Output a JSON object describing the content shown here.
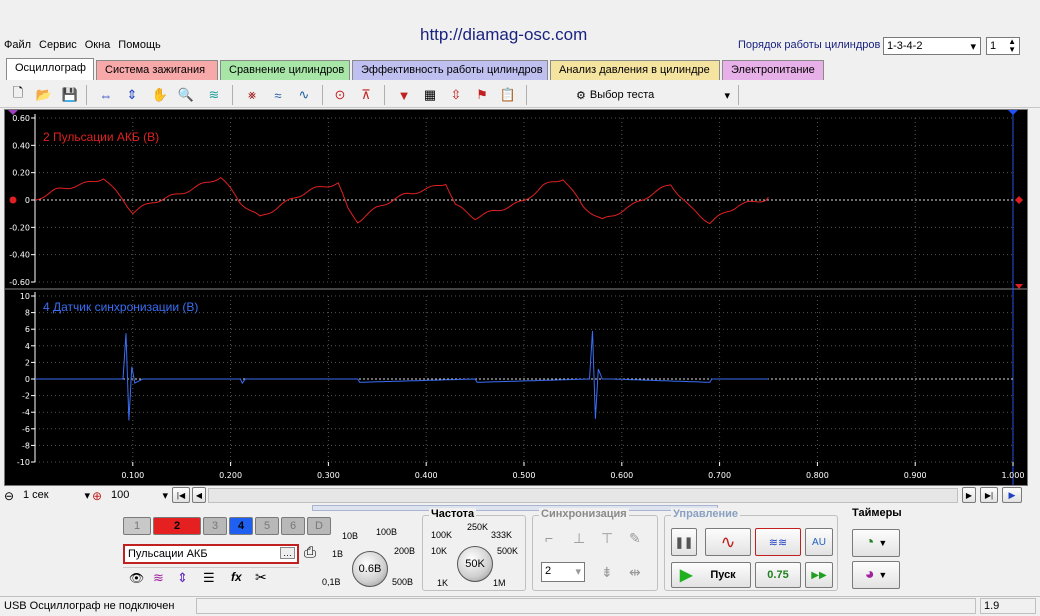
{
  "title_url": "http://diamag-osc.com",
  "menu": [
    "Файл",
    "Сервис",
    "Окна",
    "Помощь"
  ],
  "cyl_order": {
    "label": "Порядок работы цилиндров",
    "value": "1-3-4-2",
    "count": "1"
  },
  "tabs": [
    {
      "label": "Осциллограф",
      "color": "#f0f0f0",
      "active": true
    },
    {
      "label": "Система зажигания",
      "color": "#f7a8a8"
    },
    {
      "label": "Сравнение цилиндров",
      "color": "#a8e6a8"
    },
    {
      "label": "Эффективность работы цилиндров",
      "color": "#c0c0f0"
    },
    {
      "label": "Анализ давления в цилиндре",
      "color": "#f5e4a0"
    },
    {
      "label": "Электропитание",
      "color": "#e8b0e8"
    }
  ],
  "test_select": "Выбор теста",
  "chart_data": [
    {
      "type": "line",
      "title": "2 Пульсации АКБ (В)",
      "color": "#e02020",
      "ylim": [
        -0.6,
        0.6
      ],
      "yticks": [
        "0.60",
        "0.40",
        "0.20",
        "0",
        "-0.20",
        "-0.40",
        "-0.60"
      ],
      "x": [
        0.0,
        0.02,
        0.05,
        0.07,
        0.09,
        0.1,
        0.12,
        0.15,
        0.19,
        0.21,
        0.23,
        0.25,
        0.28,
        0.31,
        0.32,
        0.33,
        0.35,
        0.38,
        0.42,
        0.43,
        0.45,
        0.47,
        0.5,
        0.52,
        0.54,
        0.56,
        0.58,
        0.61,
        0.65,
        0.67,
        0.69,
        0.72,
        0.75
      ],
      "y": [
        0.0,
        0.06,
        0.12,
        0.17,
        0.0,
        -0.1,
        -0.02,
        0.06,
        0.16,
        -0.02,
        -0.12,
        -0.04,
        0.06,
        0.13,
        -0.06,
        -0.15,
        -0.06,
        0.04,
        0.13,
        -0.04,
        -0.14,
        -0.08,
        0.0,
        0.1,
        0.15,
        -0.04,
        -0.14,
        -0.05,
        0.12,
        -0.05,
        -0.17,
        -0.04,
        0.02
      ]
    },
    {
      "type": "line",
      "title": "4 Датчик синхронизации (В)",
      "color": "#3a6ef5",
      "ylim": [
        -10,
        10
      ],
      "yticks": [
        "10",
        "8",
        "6",
        "4",
        "2",
        "0",
        "-2",
        "-4",
        "-6",
        "-8",
        "-10"
      ],
      "x": [
        0.0,
        0.09,
        0.093,
        0.096,
        0.099,
        0.102,
        0.11,
        0.21,
        0.212,
        0.215,
        0.33,
        0.332,
        0.45,
        0.452,
        0.567,
        0.57,
        0.573,
        0.576,
        0.58,
        0.59,
        0.69,
        0.692,
        0.75
      ],
      "y": [
        0,
        0,
        5.5,
        -5.0,
        1.5,
        -0.5,
        0,
        0,
        -0.5,
        0,
        0,
        -0.4,
        0,
        -0.4,
        0,
        5.8,
        -4.8,
        1.2,
        0,
        0,
        -0.4,
        0,
        0
      ],
      "xticks": [
        "0.100",
        "0.200",
        "0.300",
        "0.400",
        "0.500",
        "0.600",
        "0.700",
        "0.800",
        "0.900",
        "1.000"
      ],
      "xlim": [
        0,
        1.0
      ]
    }
  ],
  "nav": {
    "time": "1 сек",
    "zoom": "100"
  },
  "channels": [
    "1",
    "2",
    "3",
    "4",
    "5",
    "6",
    "D"
  ],
  "channel_name": "Пульсации АКБ",
  "volt": {
    "value": "0.6В",
    "ticks": [
      "10В",
      "100В",
      "1В",
      "200В",
      "0,1В",
      "500В"
    ]
  },
  "freq": {
    "title": "Частота",
    "value": "50K",
    "ticks": [
      "250K",
      "100K",
      "333K",
      "10K",
      "500K",
      "1K",
      "1M"
    ]
  },
  "sync": {
    "title": "Синхронизация",
    "value": "2"
  },
  "control": {
    "title": "Управление",
    "start": "Пуск",
    "level": "0.75"
  },
  "timers": {
    "title": "Таймеры"
  },
  "status": {
    "left": "USB Осциллограф не подключен",
    "right": "1.9"
  }
}
